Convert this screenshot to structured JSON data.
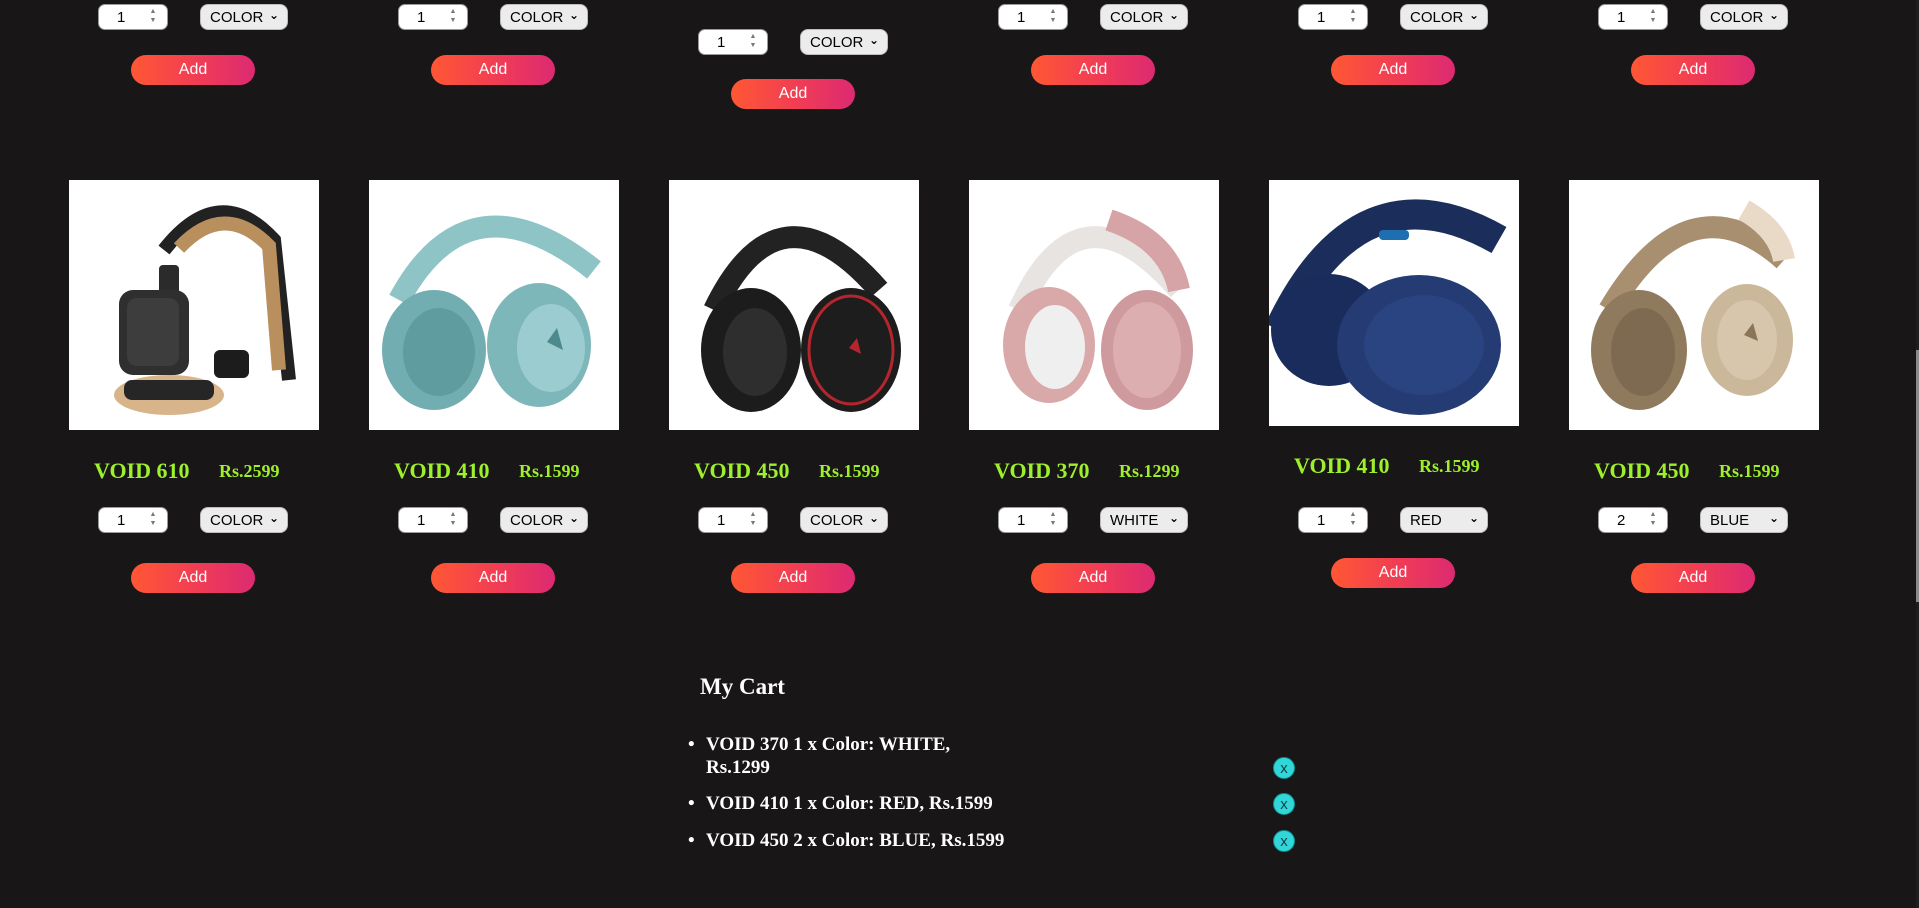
{
  "top_row": [
    {
      "qty": "1",
      "color": "COLOR",
      "add_label": "Add"
    },
    {
      "qty": "1",
      "color": "COLOR",
      "add_label": "Add"
    },
    {
      "qty": "1",
      "color": "COLOR",
      "add_label": "Add"
    },
    {
      "qty": "1",
      "color": "COLOR",
      "add_label": "Add"
    },
    {
      "qty": "1",
      "color": "COLOR",
      "add_label": "Add"
    },
    {
      "qty": "1",
      "color": "COLOR",
      "add_label": "Add"
    }
  ],
  "products": [
    {
      "name": "VOID 610",
      "price": "Rs.2599",
      "qty": "1",
      "color": "COLOR",
      "add_label": "Add",
      "image_icon": "headphones-wooden-icon"
    },
    {
      "name": "VOID 410",
      "price": "Rs.1599",
      "qty": "1",
      "color": "COLOR",
      "add_label": "Add",
      "image_icon": "headphones-teal-icon"
    },
    {
      "name": "VOID 450",
      "price": "Rs.1599",
      "qty": "1",
      "color": "COLOR",
      "add_label": "Add",
      "image_icon": "headphones-black-red-icon"
    },
    {
      "name": "VOID 370",
      "price": "Rs.1299",
      "qty": "1",
      "color": "WHITE",
      "add_label": "Add",
      "image_icon": "headphones-pink-icon"
    },
    {
      "name": "VOID 410",
      "price": "Rs.1599",
      "qty": "1",
      "color": "RED",
      "add_label": "Add",
      "image_icon": "headphones-navy-icon"
    },
    {
      "name": "VOID 450",
      "price": "Rs.1599",
      "qty": "2",
      "color": "BLUE",
      "add_label": "Add",
      "image_icon": "headphones-beige-icon"
    }
  ],
  "cart": {
    "title": "My Cart",
    "items": [
      {
        "line1": "VOID 370 1 x Color: WHITE,",
        "line2": "Rs.1299",
        "remove_label": "x"
      },
      {
        "line1": "VOID 410 1 x Color: RED, Rs.1599",
        "line2": "",
        "remove_label": "x"
      },
      {
        "line1": "VOID 450 2 x Color: BLUE, Rs.1599",
        "line2": "",
        "remove_label": "x"
      }
    ]
  },
  "colors": {
    "background": "#181616",
    "product_text": "#9ef02c",
    "button_gradient_start": "#ff5734",
    "button_gradient_end": "#dc2a72",
    "remove_button": "#31d6d8"
  }
}
